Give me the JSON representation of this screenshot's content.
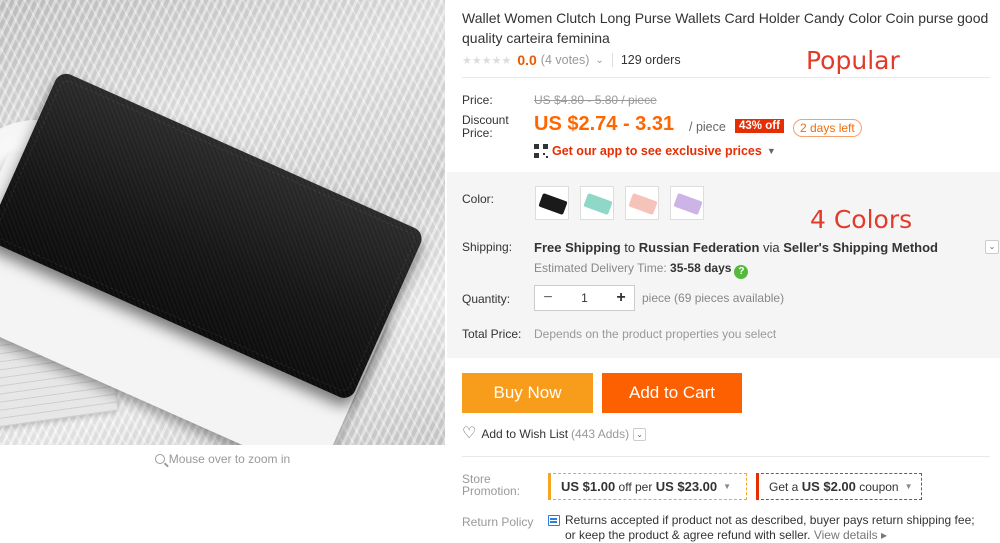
{
  "product": {
    "title": "Wallet Women Clutch Long Purse Wallets Card Holder Candy Color Coin purse good quality carteira feminina",
    "stars": "★★★★★",
    "rating": "0.0",
    "votes": "(4 votes)",
    "orders": "129 orders"
  },
  "image": {
    "zoom_hint": "Mouse over to zoom in"
  },
  "pricing": {
    "price_label": "Price:",
    "old_price": "US $4.80 - 5.80 / piece",
    "discount_label_1": "Discount",
    "discount_label_2": "Price:",
    "price": "US $2.74 - 3.31",
    "per": "/ piece",
    "off_badge": "43% off",
    "days_left": "2 days left",
    "app_text": "Get our app to see exclusive prices"
  },
  "annotations": {
    "popular": "Popular",
    "colors": "4 Colors"
  },
  "options": {
    "color_label": "Color:",
    "swatches": [
      {
        "name": "black",
        "color": "#1a1a1a"
      },
      {
        "name": "mint",
        "color": "#8fd8c8"
      },
      {
        "name": "pink",
        "color": "#f6c3bb"
      },
      {
        "name": "lavender",
        "color": "#cdb4e6"
      }
    ],
    "shipping_label": "Shipping:",
    "shipping_free": "Free Shipping",
    "shipping_to": " to ",
    "shipping_country": "Russian Federation",
    "shipping_via": " via ",
    "shipping_method": "Seller's Shipping Method",
    "delivery_label": "Estimated Delivery Time: ",
    "delivery_days": "35-58 days",
    "quantity_label": "Quantity:",
    "quantity_value": "1",
    "quantity_note": "piece (69 pieces available)",
    "total_label": "Total Price:",
    "total_note": "Depends on the product properties you select"
  },
  "actions": {
    "buy_now": "Buy Now",
    "add_to_cart": "Add to Cart",
    "wishlist": "Add to Wish List",
    "wishlist_count": "(443 Adds)"
  },
  "promotion": {
    "label_1": "Store",
    "label_2": "Promotion:",
    "coupon1_amount": "US $1.00",
    "coupon1_mid": " off per ",
    "coupon1_min": "US $23.00",
    "coupon2_pre": "Get a ",
    "coupon2_amount": "US $2.00",
    "coupon2_post": " coupon"
  },
  "return_policy": {
    "label": "Return Policy",
    "text": "Returns accepted if product not as described, buyer pays return shipping fee; or keep the product & agree refund with seller.",
    "link": "View details"
  },
  "colors": {
    "accent_orange": "#ff6600",
    "buy_now_bg": "#f89c1c",
    "add_to_cart_bg": "#fc6000",
    "badge_red": "#e62e04",
    "annotation_red": "#e33a2a"
  }
}
